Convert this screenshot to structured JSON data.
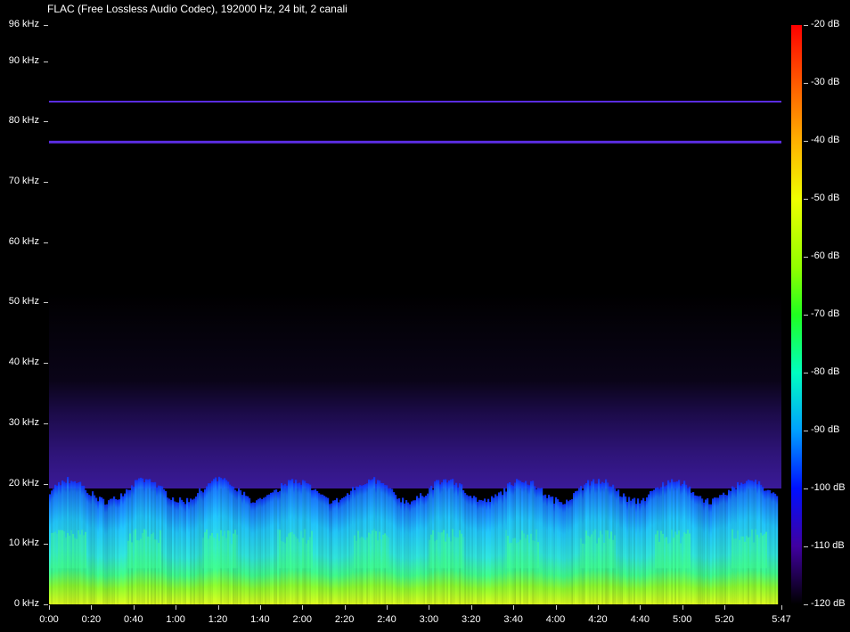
{
  "header": {
    "title": "FLAC (Free Lossless Audio Codec), 192000 Hz, 24 bit, 2 canali"
  },
  "chart_data": {
    "type": "heatmap",
    "title": "",
    "duration": "5:47",
    "y_labels": [
      "96 kHz",
      "90 kHz",
      "80 kHz",
      "70 kHz",
      "60 kHz",
      "50 kHz",
      "40 kHz",
      "30 kHz",
      "20 kHz",
      "10 kHz",
      "0 kHz"
    ],
    "y_values_khz": [
      96,
      90,
      80,
      70,
      60,
      50,
      40,
      30,
      20,
      10,
      0
    ],
    "ylim_khz": [
      0,
      96
    ],
    "x_labels": [
      "0:00",
      "0:20",
      "0:40",
      "1:00",
      "1:20",
      "1:40",
      "2:00",
      "2:20",
      "2:40",
      "3:00",
      "3:20",
      "3:40",
      "4:00",
      "4:20",
      "4:40",
      "5:00",
      "5:20",
      "5:47"
    ],
    "x_values_s": [
      0,
      20,
      40,
      60,
      80,
      100,
      120,
      140,
      160,
      180,
      200,
      220,
      240,
      260,
      280,
      300,
      320,
      347
    ],
    "xlim_s": [
      0,
      347
    ],
    "db_labels": [
      "-20 dB",
      "-30 dB",
      "-40 dB",
      "-50 dB",
      "-60 dB",
      "-70 dB",
      "-80 dB",
      "-90 dB",
      "-100 dB",
      "-110 dB",
      "-120 dB"
    ],
    "db_values": [
      -20,
      -30,
      -40,
      -50,
      -60,
      -70,
      -80,
      -90,
      -100,
      -110,
      -120
    ],
    "dblim": [
      -120,
      -20
    ],
    "tones_khz": [
      83.3,
      76.6
    ],
    "colors": {
      "background": "#000000",
      "tone": "#5a2ce0",
      "band_0_5": "#b8ff20",
      "band_5_10": "#40ff90",
      "band_10_20": "#20d8ff",
      "band_edge": "#1030ff",
      "band_20_50": "#3a1590"
    }
  }
}
